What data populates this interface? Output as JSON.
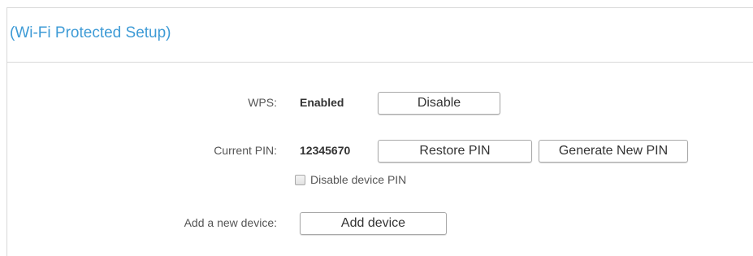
{
  "section": {
    "title": "(Wi-Fi Protected Setup)"
  },
  "wps": {
    "label": "WPS:",
    "status": "Enabled",
    "disable_button": "Disable"
  },
  "pin": {
    "label": "Current PIN:",
    "value": "12345670",
    "restore_button": "Restore PIN",
    "generate_button": "Generate New PIN",
    "disable_checkbox_label": "Disable device PIN",
    "disable_checkbox_checked": false
  },
  "add_device": {
    "label": "Add a new device:",
    "button": "Add device"
  },
  "colors": {
    "title": "#3e9bd6",
    "border": "#d8d8d8"
  }
}
